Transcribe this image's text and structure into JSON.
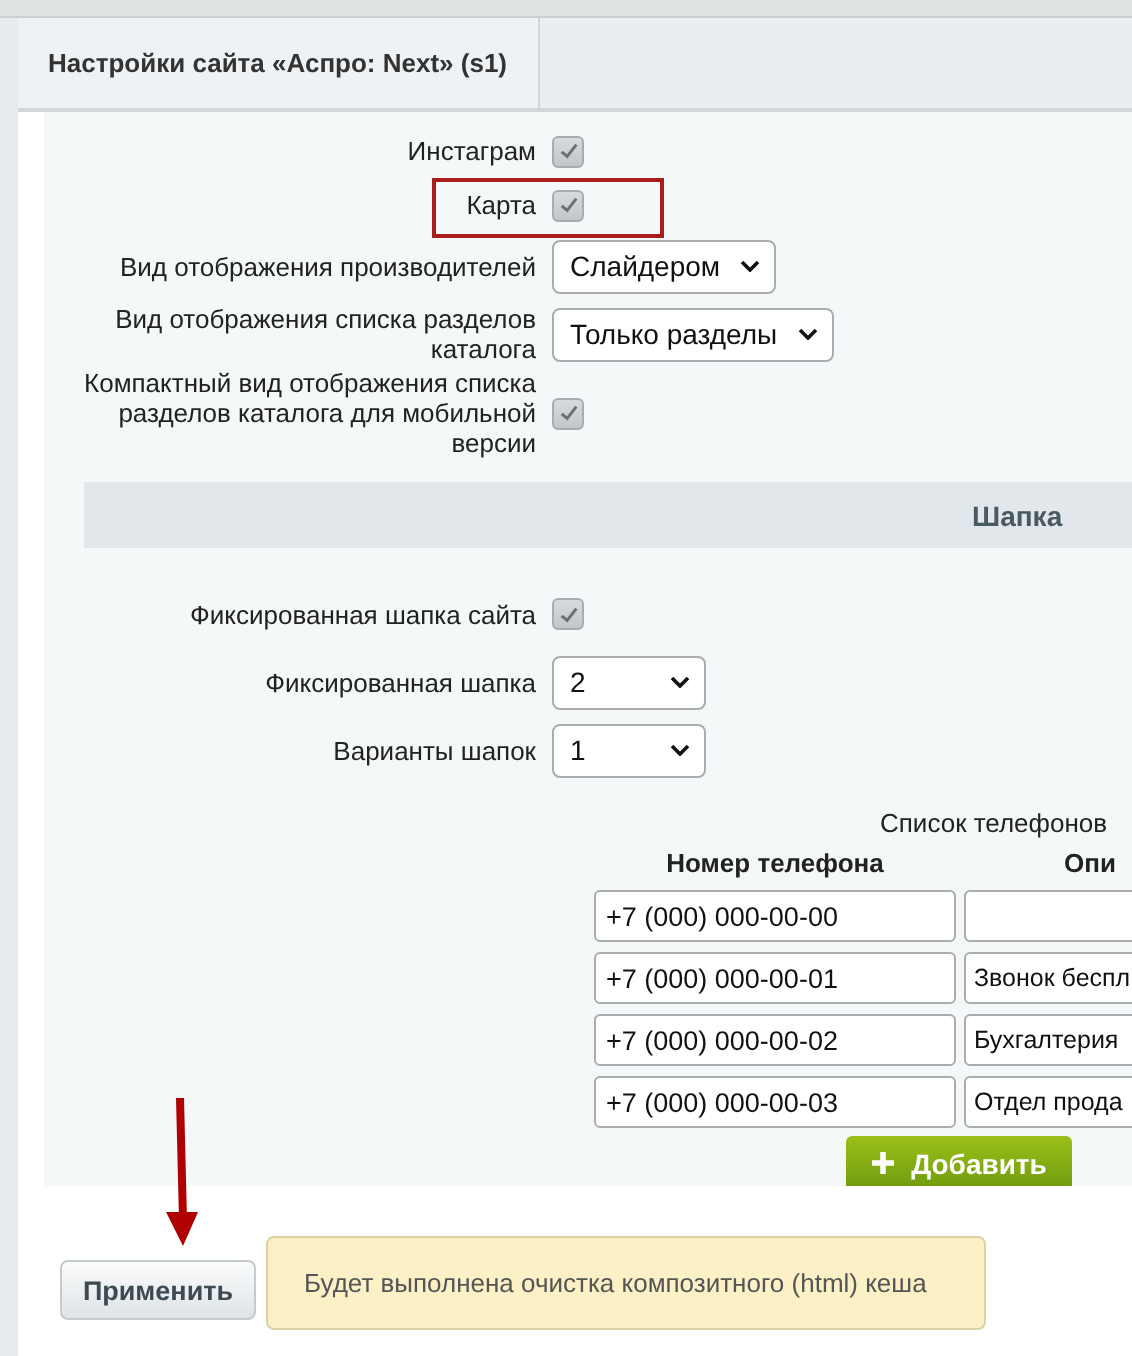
{
  "tab": {
    "title": "Настройки сайта «Аспро: Next» (s1)",
    "selected": true
  },
  "fields": [
    {
      "kind": "checkbox",
      "label": "Инстаграм",
      "checked": true,
      "highlighted": false
    },
    {
      "kind": "checkbox",
      "label": "Карта",
      "checked": true,
      "highlighted": true
    },
    {
      "kind": "select",
      "label": "Вид отображения производителей",
      "value": "Слайдером"
    },
    {
      "kind": "select",
      "label": "Вид отображения списка разделов каталога",
      "value": "Только разделы"
    },
    {
      "kind": "checkbox",
      "label": "Компактный вид отображения списка разделов каталога для мобильной версии",
      "checked": true,
      "highlighted": false
    }
  ],
  "section": {
    "title": "Шапка"
  },
  "header_fields": [
    {
      "kind": "checkbox",
      "label": "Фиксированная шапка сайта",
      "checked": true
    },
    {
      "kind": "select",
      "label": "Фиксированная шапка",
      "value": "2"
    },
    {
      "kind": "select",
      "label": "Варианты шапок",
      "value": "1"
    }
  ],
  "phones": {
    "title": "Список телефонов",
    "columns": [
      "Номер телефона",
      "Опи"
    ],
    "rows": [
      {
        "number": "+7 (000) 000-00-00",
        "description": ""
      },
      {
        "number": "+7 (000) 000-00-01",
        "description": "Звонок беспл"
      },
      {
        "number": "+7 (000) 000-00-02",
        "description": "Бухгалтерия"
      },
      {
        "number": "+7 (000) 000-00-03",
        "description": "Отдел прода"
      }
    ],
    "add_button": "Добавить"
  },
  "footer": {
    "apply_button": "Применить",
    "notice": "Будет выполнена очистка композитного (html) кеша"
  }
}
